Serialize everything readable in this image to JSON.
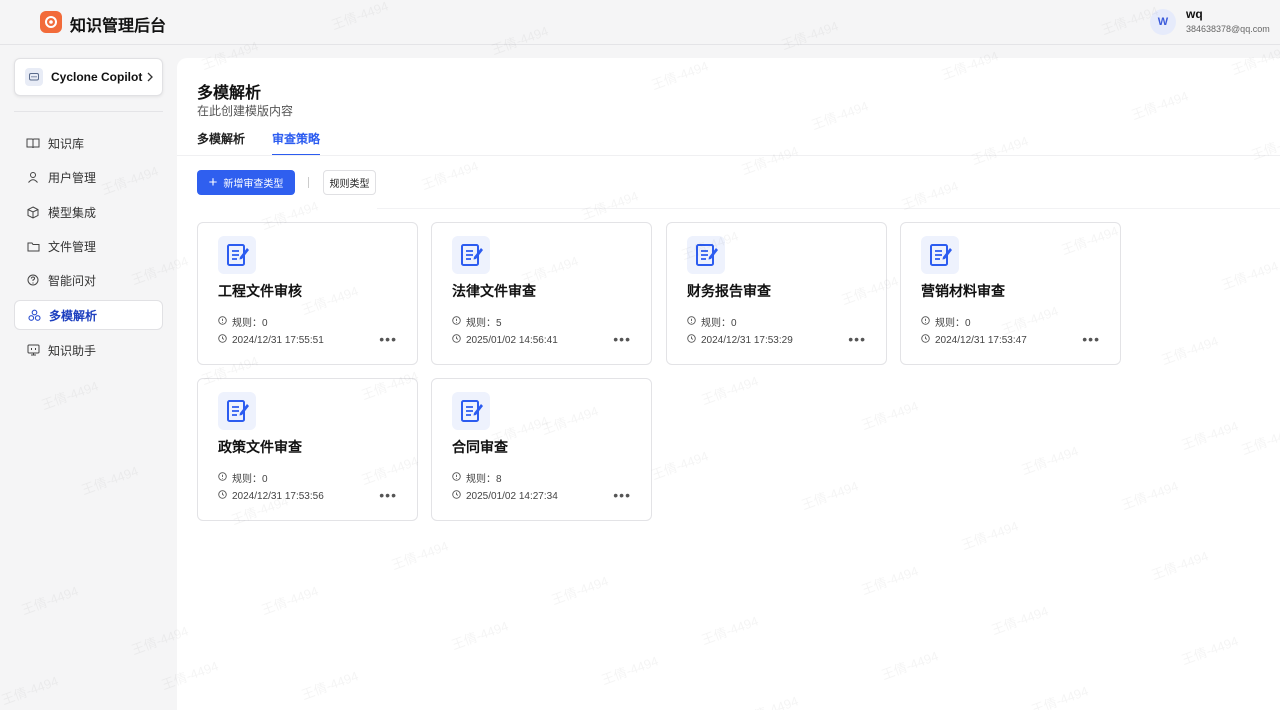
{
  "app": {
    "title": "知识管理后台"
  },
  "user": {
    "initial": "W",
    "name": "wq",
    "email": "384638378@qq.com"
  },
  "sidebar": {
    "copilot": {
      "label": "Cyclone Copilot"
    },
    "items": [
      {
        "label": "知识库",
        "icon": "book-icon"
      },
      {
        "label": "用户管理",
        "icon": "user-icon"
      },
      {
        "label": "模型集成",
        "icon": "cube-icon"
      },
      {
        "label": "文件管理",
        "icon": "folder-icon"
      },
      {
        "label": "智能问对",
        "icon": "question-icon"
      },
      {
        "label": "多模解析",
        "icon": "multi-node-icon",
        "active": true
      },
      {
        "label": "知识助手",
        "icon": "monitor-icon"
      }
    ]
  },
  "page": {
    "title": "多模解析",
    "subtitle": "在此创建模版内容",
    "tabs": [
      {
        "label": "多模解析"
      },
      {
        "label": "审查策略",
        "active": true
      }
    ]
  },
  "toolbar": {
    "add_label": "新增审查类型",
    "rule_type_label": "规则类型"
  },
  "cards": [
    {
      "title": "工程文件审核",
      "rules": "规则：0",
      "time": "2024/12/31 17:55:51"
    },
    {
      "title": "法律文件审查",
      "rules": "规则：5",
      "time": "2025/01/02 14:56:41"
    },
    {
      "title": "财务报告审查",
      "rules": "规则：0",
      "time": "2024/12/31 17:53:29"
    },
    {
      "title": "营销材料审查",
      "rules": "规则：0",
      "time": "2024/12/31 17:53:47"
    },
    {
      "title": "政策文件审查",
      "rules": "规则：0",
      "time": "2024/12/31 17:53:56"
    },
    {
      "title": "合同审查",
      "rules": "规则：8",
      "time": "2025/01/02 14:27:34"
    }
  ],
  "watermark": "王倩-4494",
  "colors": {
    "accent": "#2f5fef",
    "logo": "#f26b3a"
  }
}
